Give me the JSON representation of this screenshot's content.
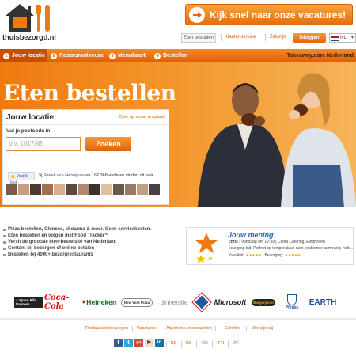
{
  "header": {
    "logo_text": "thuisbezorgd.nl",
    "vacancy_banner": "Kijk snel naar onze vacatures!",
    "utility": {
      "active": "Eten bestellen",
      "links": [
        "Klantenservice",
        "Zakelijk"
      ],
      "login": "Inloggen",
      "language": "NL"
    }
  },
  "nav": {
    "tabs": [
      {
        "num": "1",
        "label": "Jouw locatie"
      },
      {
        "num": "2",
        "label": "Restaurantkeuze"
      },
      {
        "num": "3",
        "label": "Menukaart"
      },
      {
        "num": "4",
        "label": "Bestellen"
      }
    ],
    "right_text": "Takeaway.com Nederland"
  },
  "hero": {
    "title": "Eten bestellen",
    "panel": {
      "title": "Jouw locatie:",
      "link": "Zoek op straat en plaats",
      "label": "Vul je postcode in:",
      "placeholder": "b.v. 1017AB",
      "button": "Zoeken",
      "fb_like": "Vind ik leuk",
      "fb_prefix": "Jij,",
      "fb_name": "Freek van Herwijnen",
      "fb_rest": "en 162.368 anderen vinden dit leuk."
    }
  },
  "features": [
    "Pizza bestellen, Chinees, shoarma & meer. Geen servicekosten.",
    "Eten bestellen en volgen met Food Tracker™",
    "Versit de grootste eten-bestelsite van Nederland",
    "Contant bij bezorgen of online betalen",
    "Bestellen bij 4000+ bezorgrestaurants"
  ],
  "review": {
    "title": "Jouw mening:",
    "meta_name": "chris",
    "meta_rest": "| Vandaag om 12:39 | China Catering, Eindhoven",
    "body": "keurig op tijd. Perfect op temperatuur. ruim voldoende aanwezig. nett...",
    "quality_label": "Kwaliteit:",
    "delivery_label": "Bezorging:",
    "quality_rating": 5,
    "delivery_rating": 5,
    "stars": "★★★★★"
  },
  "brands": [
    "Spare Rib Express",
    "Coca-Cola",
    "Heineken",
    "New York Pizza",
    "dinnersite",
    "Domino's",
    "Microsoft",
    "Burgerpoint",
    "Philips",
    "Earth"
  ],
  "footer": {
    "links": [
      "Restaurant toevoegen",
      "Vacatures",
      "Algemene voorwaarden",
      "Colofon",
      "Wie zijn wij"
    ],
    "social": [
      "f",
      "t",
      "g+",
      "▶",
      "in"
    ],
    "countries": [
      "BE",
      "DE",
      "GB",
      "FR",
      "AT"
    ]
  },
  "colors": {
    "accent": "#f07a10",
    "nav_active": "#c74e02",
    "link": "#e05a00"
  }
}
